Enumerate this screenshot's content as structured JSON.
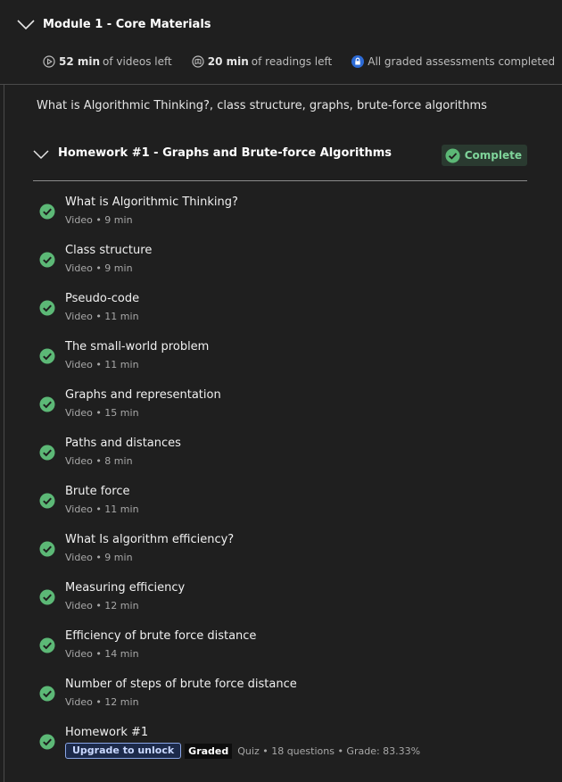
{
  "module": {
    "title": "Module 1 - Core Materials",
    "videos_value": "52 min",
    "videos_text": "of videos left",
    "readings_value": "20 min",
    "readings_text": "of readings left",
    "assessments_text": "All graded assessments completed"
  },
  "description": "What is Algorithmic Thinking?, class structure, graphs, brute-force algorithms",
  "homework": {
    "title": "Homework #1 - Graphs and Brute-force Algorithms",
    "status": "Complete"
  },
  "items": [
    {
      "title": "What is Algorithmic Thinking?",
      "meta": "Video • 9 min"
    },
    {
      "title": "Class structure",
      "meta": "Video • 9 min"
    },
    {
      "title": "Pseudo-code",
      "meta": "Video • 11 min"
    },
    {
      "title": "The small-world problem",
      "meta": "Video • 11 min"
    },
    {
      "title": "Graphs and representation",
      "meta": "Video • 15 min"
    },
    {
      "title": "Paths and distances",
      "meta": "Video • 8 min"
    },
    {
      "title": "Brute force",
      "meta": "Video • 11 min"
    },
    {
      "title": "What Is algorithm efficiency?",
      "meta": "Video • 9 min"
    },
    {
      "title": "Measuring efficiency",
      "meta": "Video • 12 min"
    },
    {
      "title": "Efficiency of brute force distance",
      "meta": "Video • 14 min"
    },
    {
      "title": "Number of steps of brute force distance",
      "meta": "Video • 12 min"
    }
  ],
  "quiz_item": {
    "title": "Homework #1",
    "upgrade_label": "Upgrade to unlock",
    "graded_label": "Graded",
    "meta": "Quiz • 18 questions • Grade: 83.33%"
  },
  "colors": {
    "background": "#1f1f1f",
    "check_green": "#5cb876",
    "complete_text": "#7fd49a",
    "upgrade_border": "#8aa6e8",
    "lock_blue": "#2d6bd6"
  },
  "icons": {
    "module_toggle": "chevron-down-icon",
    "videos": "play-circle-icon",
    "readings": "book-circle-icon",
    "assessments": "lock-icon",
    "item_status": "check-circle-icon"
  }
}
